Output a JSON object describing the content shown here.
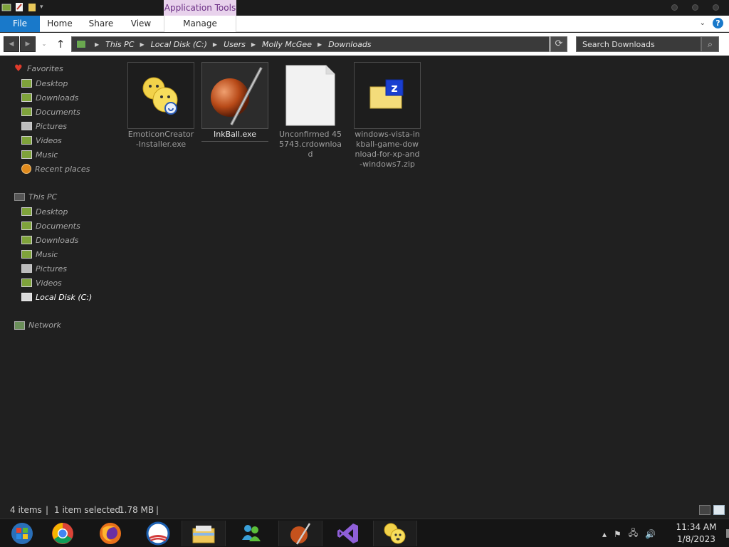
{
  "titlebar": {
    "contextual_tab": "Application Tools"
  },
  "ribbon": {
    "tabs": [
      "File",
      "Home",
      "Share",
      "View",
      "Manage"
    ]
  },
  "address": {
    "crumbs": [
      "This PC",
      "Local Disk (C:)",
      "Users",
      "Molly McGee",
      "Downloads"
    ]
  },
  "search": {
    "placeholder": "Search Downloads"
  },
  "sidebar": {
    "favorites_label": "Favorites",
    "favorites": [
      "Desktop",
      "Downloads",
      "Documents",
      "Pictures",
      "Videos",
      "Music",
      "Recent places"
    ],
    "thispc_label": "This PC",
    "thispc": [
      "Desktop",
      "Documents",
      "Downloads",
      "Music",
      "Pictures",
      "Videos",
      "Local Disk (C:)"
    ],
    "network_label": "Network"
  },
  "files": [
    {
      "name": "EmoticonCreator-Installer.exe",
      "icon": "emoticon-installer-icon"
    },
    {
      "name": "InkBall.exe",
      "icon": "inkball-icon"
    },
    {
      "name": "Unconfirmed 455743.crdownload",
      "icon": "blank-file-icon"
    },
    {
      "name": "windows-vista-inkball-game-download-for-xp-and-windows7.zip",
      "icon": "zip-icon"
    }
  ],
  "status": {
    "items": "4 items",
    "selected": "1 item selected",
    "size": "1.78 MB"
  },
  "taskbar": {
    "time": "11:34 AM",
    "date": "1/8/2023"
  },
  "colors": {
    "file_tab": "#1979ca",
    "contextual_tab_bg": "#e8d2ec",
    "window_bg": "#202020"
  }
}
